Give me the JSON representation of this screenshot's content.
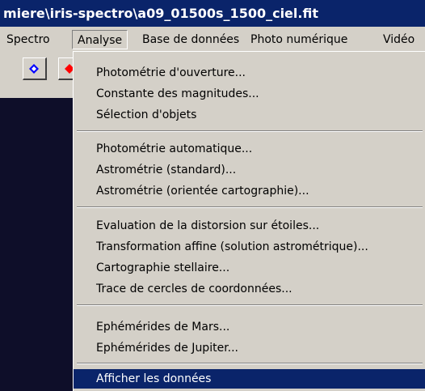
{
  "window": {
    "title": "miere\\iris-spectro\\a09_01500s_1500_ciel.fit"
  },
  "menubar": {
    "items": [
      "Spectro",
      "Analyse",
      "Base de données",
      "Photo numérique",
      "Vidéo"
    ]
  },
  "toolbar": {
    "buttons": [
      {
        "icon": "blue-diamond-icon",
        "color": "#0000ff"
      },
      {
        "icon": "red-diamond-icon",
        "color": "#ff0000"
      }
    ]
  },
  "dropdown": {
    "groups": [
      [
        "Photométrie d'ouverture...",
        "Constante des magnitudes...",
        "Sélection d'objets"
      ],
      [
        "Photométrie automatique...",
        "Astrométrie (standard)...",
        "Astrométrie (orientée cartographie)..."
      ],
      [
        "Evaluation de la distorsion sur étoiles...",
        "Transformation affine (solution astrométrique)...",
        "Cartographie stellaire...",
        "Trace de cercles de coordonnées..."
      ],
      [
        "Ephémérides de Mars...",
        "Ephémérides de Jupiter..."
      ],
      [
        "Afficher les données"
      ]
    ],
    "highlighted": "Afficher les données"
  },
  "colors": {
    "titlebar_bg": "#0a246a",
    "highlight_bg": "#0a246a",
    "workspace_bg": "#0e0e29",
    "menu_bg": "#d4d0c8"
  }
}
